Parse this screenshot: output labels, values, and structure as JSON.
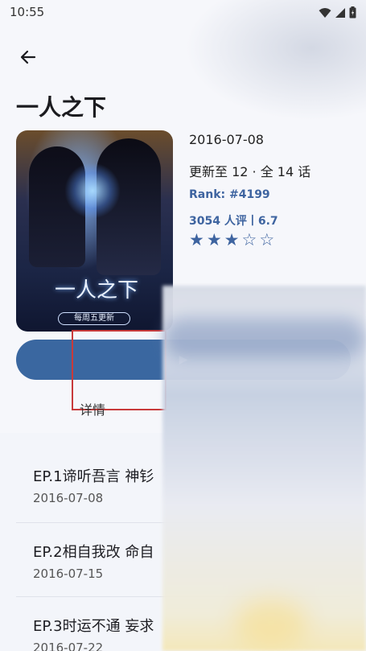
{
  "status_bar": {
    "time": "10:55"
  },
  "header": {
    "title": "一人之下"
  },
  "cover": {
    "logo_text": "一人之下",
    "banner_text": "每周五更新"
  },
  "info": {
    "date": "2016-07-08",
    "update": "更新至 12 · 全 14 话",
    "rank": "Rank: #4199",
    "rating": "3054 人评丨6.7",
    "stars": [
      "★",
      "★",
      "★",
      "☆",
      "☆"
    ]
  },
  "tabs": {
    "detail": "详情"
  },
  "episodes": [
    {
      "title": "EP.1谛听吾言 神钐",
      "date": "2016-07-08"
    },
    {
      "title": "EP.2相自我改 命自",
      "date": "2016-07-15"
    },
    {
      "title": "EP.3时运不通 妄求",
      "date": "2016-07-22"
    }
  ],
  "colors": {
    "accent": "#3a67a0",
    "rank_text": "#3e64a0",
    "overlay_frame": "#c83a3a"
  },
  "icons": {
    "back": "arrow-left-icon",
    "play": "play-icon",
    "wifi": "wifi-icon",
    "signal": "signal-icon",
    "battery": "battery-icon"
  }
}
